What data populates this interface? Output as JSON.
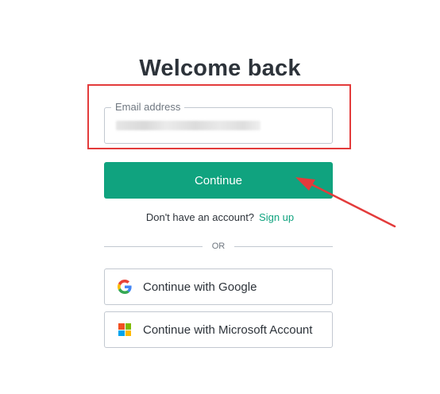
{
  "page": {
    "title": "Welcome back"
  },
  "email": {
    "label": "Email address",
    "value": "",
    "placeholder": ""
  },
  "continue_button": {
    "label": "Continue"
  },
  "signup": {
    "prompt": "Don't have an account?",
    "link_label": "Sign up"
  },
  "divider": {
    "label": "OR"
  },
  "social": {
    "google": {
      "label": "Continue with Google",
      "icon": "google-icon"
    },
    "microsoft": {
      "label": "Continue with Microsoft Account",
      "icon": "microsoft-icon"
    }
  },
  "colors": {
    "accent": "#10a37f",
    "annotation": "#e33b3b",
    "text": "#2d333a",
    "border": "#c2c8d0"
  }
}
